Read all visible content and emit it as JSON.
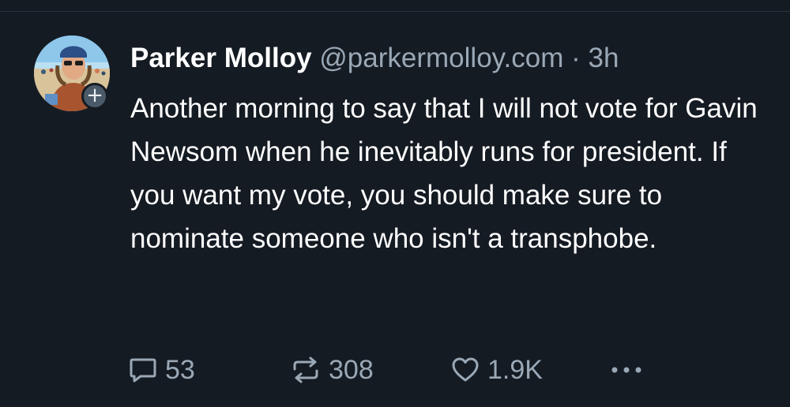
{
  "post": {
    "author": {
      "name": "Parker Molloy",
      "handle": "@parkermolloy.com",
      "separator": "·",
      "time": "3h"
    },
    "text": "Another morning to say that I will not vote for Gavin Newsom when he inevitably runs for president. If you want my vote, you should make sure to nominate someone who isn't a transphobe.",
    "avatar": {
      "follow_badge": "+"
    },
    "actions": {
      "replies": "53",
      "reposts": "308",
      "likes": "1.9K"
    }
  },
  "colors": {
    "background": "#151b23",
    "text": "#ffffff",
    "muted": "#9aa8b6",
    "badge": "#4b5a69"
  },
  "icons": [
    "reply-icon",
    "repost-icon",
    "like-icon",
    "more-icon",
    "plus-icon"
  ]
}
